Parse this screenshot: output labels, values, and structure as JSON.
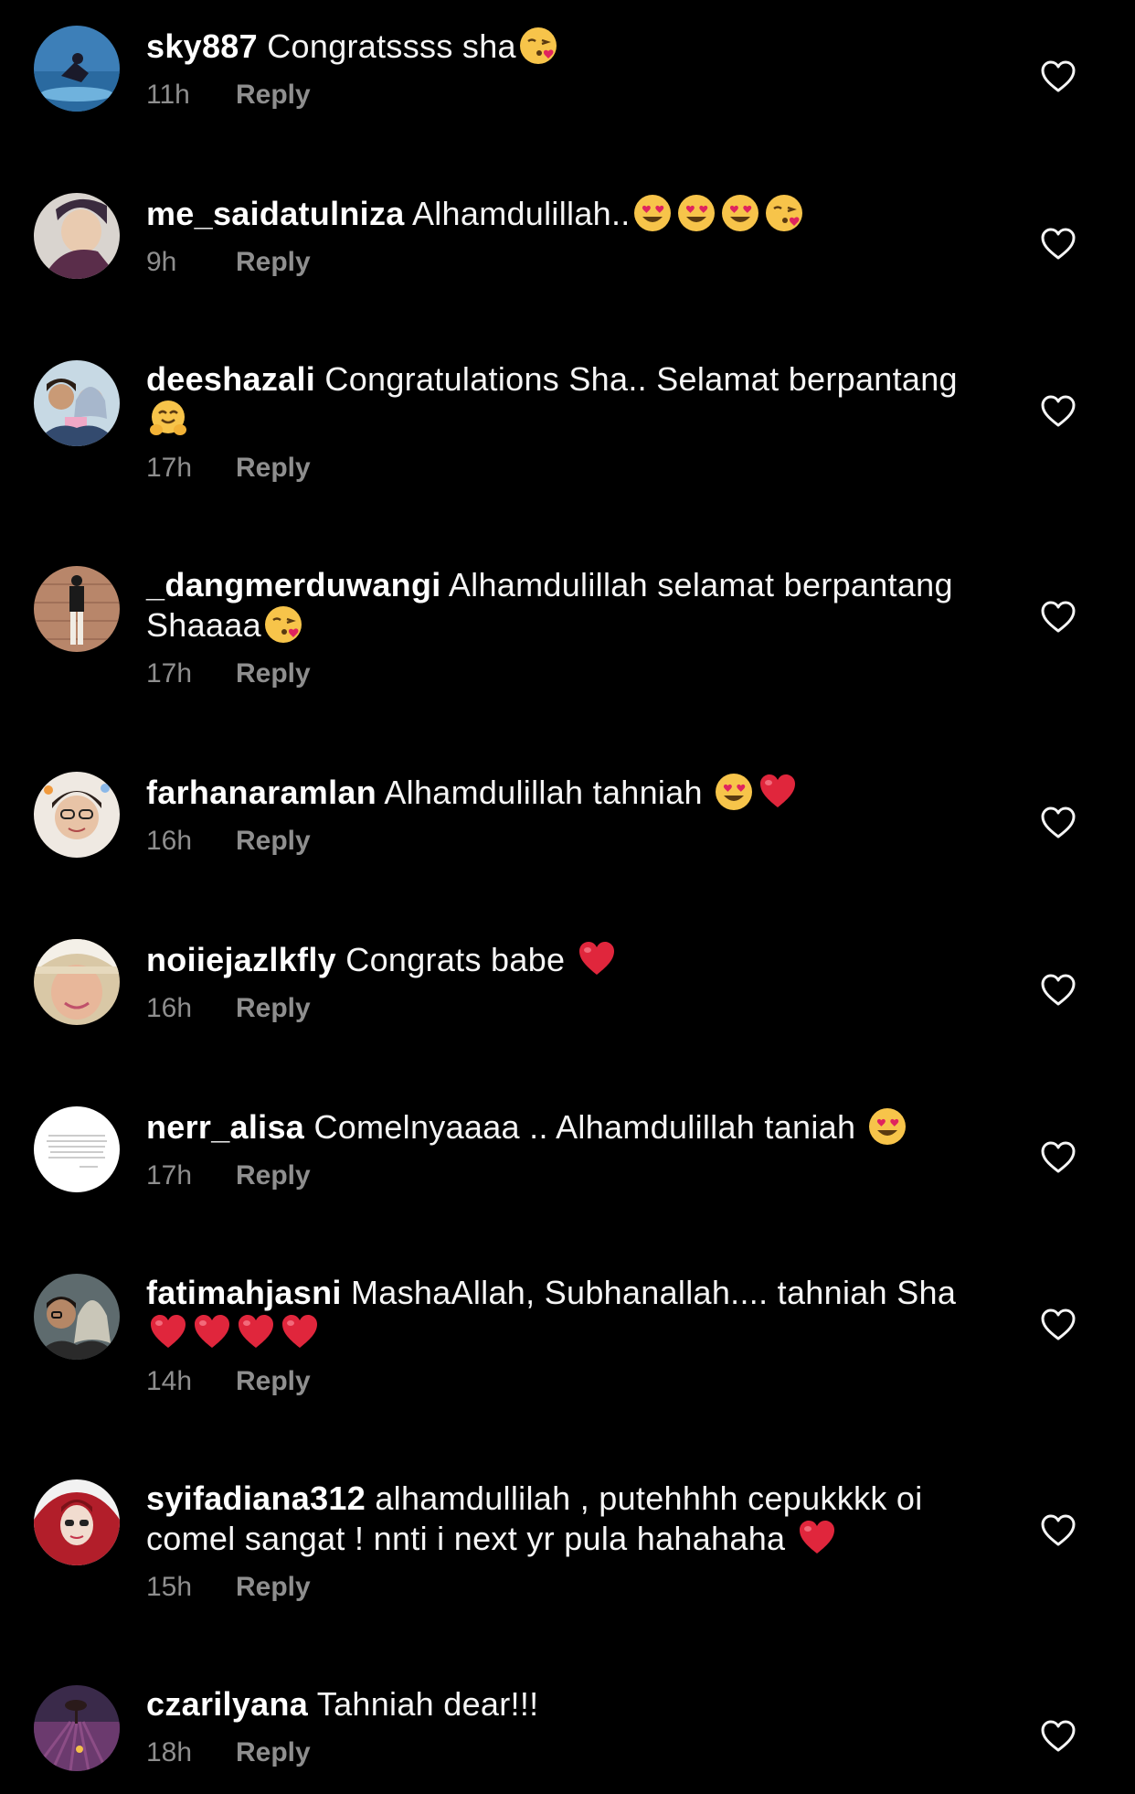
{
  "reply_label": "Reply",
  "comments": [
    {
      "username": "sky887",
      "text": "Congratssss sha",
      "emojis": [
        "kiss"
      ],
      "time": "11h"
    },
    {
      "username": "me_saidatulniza",
      "text": "Alhamdulillah..",
      "emojis": [
        "heart-eyes",
        "heart-eyes",
        "heart-eyes",
        "kiss"
      ],
      "time": "9h"
    },
    {
      "username": "deeshazali",
      "text": "Congratulations Sha.. Selamat berpantang",
      "emojis": [
        "hug"
      ],
      "time": "17h"
    },
    {
      "username": "_dangmerduwangi",
      "text": "Alhamdulillah selamat berpantang Shaaaa",
      "emojis": [
        "kiss"
      ],
      "time": "17h"
    },
    {
      "username": "farhanaramlan",
      "text": "Alhamdulillah tahniah",
      "emojis": [
        "heart-eyes",
        "red-heart"
      ],
      "time": "16h"
    },
    {
      "username": "noiiejazlkfly",
      "text": "Congrats babe",
      "emojis": [
        "red-heart"
      ],
      "time": "16h"
    },
    {
      "username": "nerr_alisa",
      "text": "Comelnyaaaa .. Alhamdulillah taniah",
      "emojis": [
        "heart-eyes"
      ],
      "time": "17h"
    },
    {
      "username": "fatimahjasni",
      "text": "MashaAllah, Subhanallah.... tahniah Sha",
      "emojis": [
        "red-heart",
        "red-heart",
        "red-heart",
        "red-heart"
      ],
      "time": "14h"
    },
    {
      "username": "syifadiana312",
      "text": "alhamdullilah , putehhhh cepukkkk oi comel sangat ! nnti i next yr pula hahahaha",
      "emojis": [
        "red-heart"
      ],
      "time": "15h"
    },
    {
      "username": "czarilyana",
      "text": "Tahniah dear!!!",
      "emojis": [],
      "time": "18h"
    }
  ]
}
